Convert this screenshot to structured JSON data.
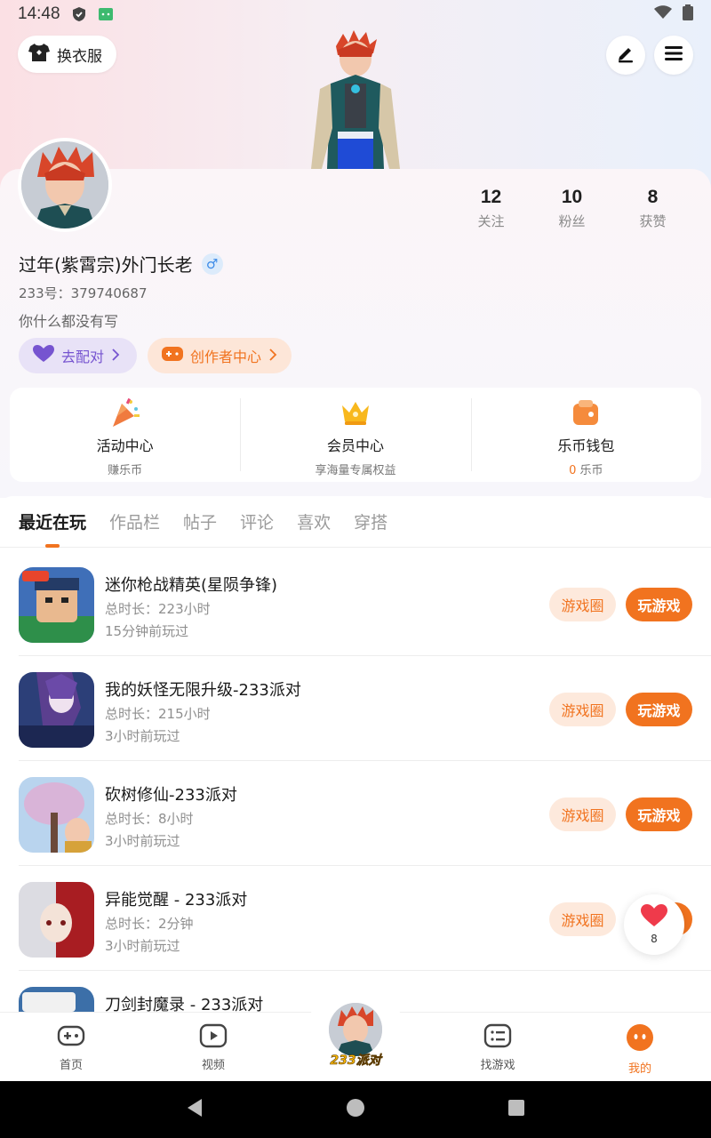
{
  "status_bar": {
    "time": "14:48"
  },
  "header": {
    "outfit_label": "换衣服",
    "edit_icon": "pen-icon",
    "menu_icon": "menu-icon"
  },
  "profile": {
    "stats": [
      {
        "value": "12",
        "label": "关注"
      },
      {
        "value": "10",
        "label": "粉丝"
      },
      {
        "value": "8",
        "label": "获赞"
      }
    ],
    "username": "过年(紫霄宗)外门长老",
    "gender_symbol": "♂",
    "uid": "233号：379740687",
    "bio": "你什么都没有写",
    "pair_button": "去配对",
    "creator_button": "创作者中心"
  },
  "quick_entries": [
    {
      "title": "活动中心",
      "sub": "赚乐币",
      "icon": "party-popper-icon"
    },
    {
      "title": "会员中心",
      "sub": "享海量专属权益",
      "icon": "crown-icon"
    },
    {
      "title": "乐币钱包",
      "sub_value": "0",
      "sub_unit": "乐币",
      "icon": "wallet-icon"
    }
  ],
  "tabs": [
    "最近在玩",
    "作品栏",
    "帖子",
    "评论",
    "喜欢",
    "穿搭"
  ],
  "active_tab": "最近在玩",
  "games": [
    {
      "title": "迷你枪战精英(星陨争锋)",
      "duration": "总时长：223小时",
      "last_played": "15分钟前玩过",
      "circle_label": "游戏圈",
      "play_label": "玩游戏"
    },
    {
      "title": "我的妖怪无限升级-233派对",
      "duration": "总时长：215小时",
      "last_played": "3小时前玩过",
      "circle_label": "游戏圈",
      "play_label": "玩游戏"
    },
    {
      "title": "砍树修仙-233派对",
      "duration": "总时长：8小时",
      "last_played": "3小时前玩过",
      "circle_label": "游戏圈",
      "play_label": "玩游戏"
    },
    {
      "title": "异能觉醒 - 233派对",
      "duration": "总时长：2分钟",
      "last_played": "3小时前玩过",
      "circle_label": "游戏圈",
      "play_label": "玩游戏"
    },
    {
      "title": "刀剑封魔录 - 233派对",
      "duration": "",
      "last_played": "",
      "circle_label": "",
      "play_label": ""
    }
  ],
  "floating_like": {
    "count": "8"
  },
  "bottom_nav": {
    "items": [
      {
        "label": "首页",
        "icon": "gamepad-icon"
      },
      {
        "label": "视频",
        "icon": "video-play-icon"
      },
      {
        "label": "找游戏",
        "icon": "list-icon"
      },
      {
        "label": "我的",
        "icon": "face-icon"
      }
    ],
    "center_label": "233派对",
    "active": "我的"
  },
  "colors": {
    "accent": "#f1731f",
    "accent_light": "#fde9dc",
    "purple": "#7654d0",
    "purple_light": "#e8e2f7"
  }
}
